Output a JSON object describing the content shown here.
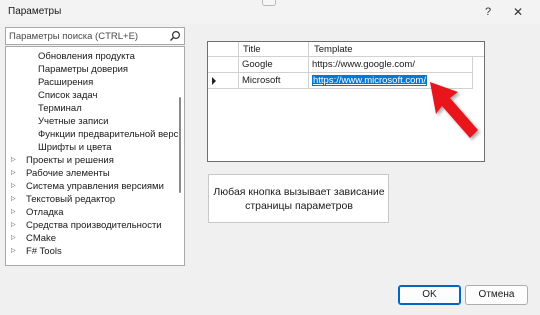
{
  "window": {
    "title": "Параметры",
    "help_glyph": "?",
    "close_glyph": "✕"
  },
  "search": {
    "placeholder": "Параметры поиска (CTRL+E)"
  },
  "tree": {
    "items": [
      {
        "label": "Обновления продукта",
        "level": "child"
      },
      {
        "label": "Параметры доверия",
        "level": "child"
      },
      {
        "label": "Расширения",
        "level": "child"
      },
      {
        "label": "Список задач",
        "level": "child"
      },
      {
        "label": "Терминал",
        "level": "child"
      },
      {
        "label": "Учетные записи",
        "level": "child"
      },
      {
        "label": "Функции предварительной верс",
        "level": "child"
      },
      {
        "label": "Шрифты и цвета",
        "level": "child"
      },
      {
        "label": "Проекты и решения",
        "level": "parent"
      },
      {
        "label": "Рабочие элементы",
        "level": "parent"
      },
      {
        "label": "Система управления версиями",
        "level": "parent"
      },
      {
        "label": "Текстовый редактор",
        "level": "parent"
      },
      {
        "label": "Отладка",
        "level": "parent"
      },
      {
        "label": "Средства производительности",
        "level": "parent"
      },
      {
        "label": "CMake",
        "level": "parent"
      },
      {
        "label": "F# Tools",
        "level": "parent"
      }
    ],
    "expander_glyph": "▷"
  },
  "grid": {
    "columns": [
      "Title",
      "Template"
    ],
    "rows": [
      {
        "title": "Google",
        "template": "https://www.google.com/",
        "current": false
      },
      {
        "title": "Microsoft",
        "template": "https://www.microsoft.com/",
        "current": true
      }
    ]
  },
  "info": {
    "line1": "Любая кнопка вызывает зависание",
    "line2": "страницы параметров"
  },
  "footer": {
    "ok_label": "OK",
    "cancel_label": "Отмена"
  },
  "colors": {
    "selection": "#0078d7",
    "arrow": "#e8141e",
    "accent_border": "#0067c0"
  }
}
